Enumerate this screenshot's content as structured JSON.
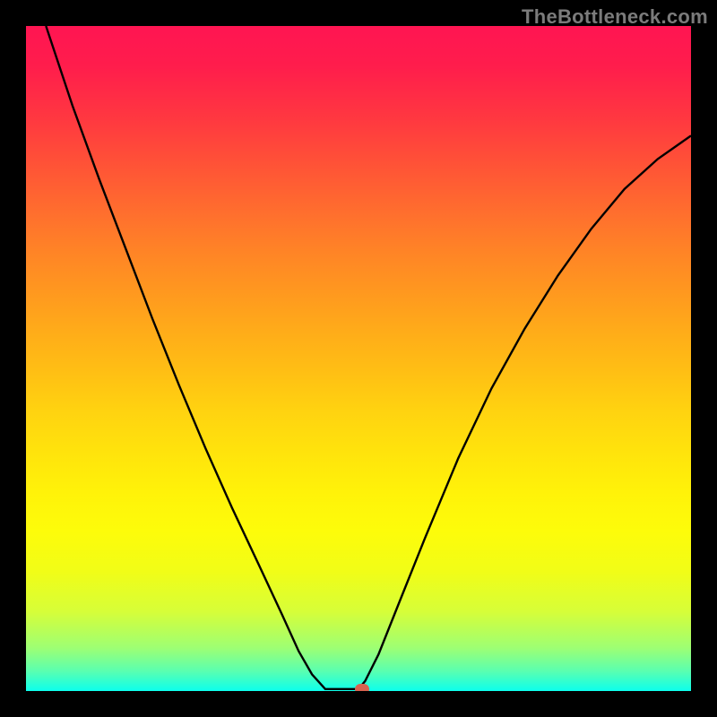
{
  "watermark": "TheBottleneck.com",
  "chart_data": {
    "type": "line",
    "title": "",
    "xlabel": "",
    "ylabel": "",
    "xlim": [
      0,
      1
    ],
    "ylim": [
      0,
      1
    ],
    "series": [
      {
        "name": "curve",
        "x": [
          0.03,
          0.07,
          0.11,
          0.15,
          0.19,
          0.23,
          0.27,
          0.31,
          0.35,
          0.385,
          0.41,
          0.43,
          0.45,
          0.455,
          0.5,
          0.51,
          0.53,
          0.56,
          0.6,
          0.65,
          0.7,
          0.75,
          0.8,
          0.85,
          0.9,
          0.95,
          1.0
        ],
        "y": [
          1.0,
          0.88,
          0.77,
          0.665,
          0.56,
          0.46,
          0.365,
          0.275,
          0.19,
          0.115,
          0.06,
          0.025,
          0.003,
          0.003,
          0.003,
          0.015,
          0.055,
          0.13,
          0.23,
          0.35,
          0.455,
          0.545,
          0.625,
          0.695,
          0.755,
          0.8,
          0.835
        ]
      }
    ],
    "marker": {
      "x": 0.505,
      "y": 0.003
    },
    "gradient_colors": [
      "#ff1552",
      "#ffe30c",
      "#0cffed"
    ]
  }
}
